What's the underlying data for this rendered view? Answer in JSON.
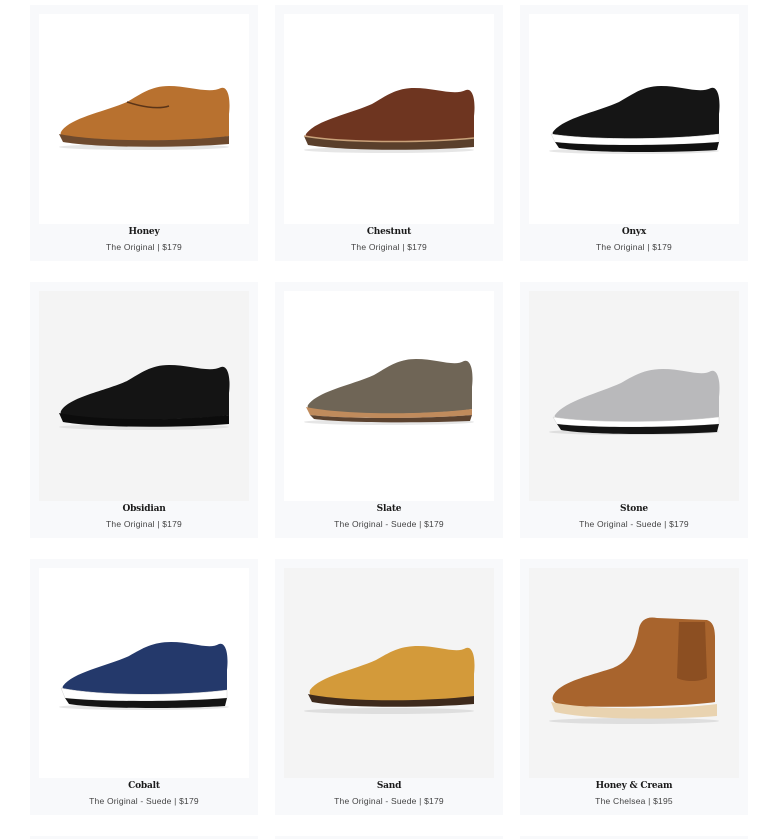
{
  "products": [
    {
      "name": "Honey",
      "subtitle": "The Original | $179",
      "upper_color": "#b8712f",
      "sole_color": "#6e4a2e",
      "style": "oxford"
    },
    {
      "name": "Chestnut",
      "subtitle": "The Original | $179",
      "upper_color": "#6e3520",
      "sole_color": "#5a3f2b",
      "style": "oxford"
    },
    {
      "name": "Onyx",
      "subtitle": "The Original | $179",
      "upper_color": "#151515",
      "sole_color": "#ffffff",
      "style": "oxford-white-sole"
    },
    {
      "name": "Obsidian",
      "subtitle": "The Original | $179",
      "upper_color": "#141414",
      "sole_color": "#111111",
      "style": "oxford-black-sole"
    },
    {
      "name": "Slate",
      "subtitle": "The Original - Suede | $179",
      "upper_color": "#6f6556",
      "sole_color": "#a57b55",
      "style": "oxford"
    },
    {
      "name": "Stone",
      "subtitle": "The Original - Suede | $179",
      "upper_color": "#b9b9bb",
      "sole_color": "#ffffff",
      "style": "oxford-white-sole"
    },
    {
      "name": "Cobalt",
      "subtitle": "The Original - Suede | $179",
      "upper_color": "#24396b",
      "sole_color": "#ffffff",
      "style": "oxford-white-sole"
    },
    {
      "name": "Sand",
      "subtitle": "The Original - Suede | $179",
      "upper_color": "#d39a3a",
      "sole_color": "#4a3322",
      "style": "oxford"
    },
    {
      "name": "Honey & Cream",
      "subtitle": "The Chelsea | $195",
      "upper_color": "#a8642d",
      "sole_color": "#e9d3b0",
      "style": "chelsea"
    }
  ]
}
